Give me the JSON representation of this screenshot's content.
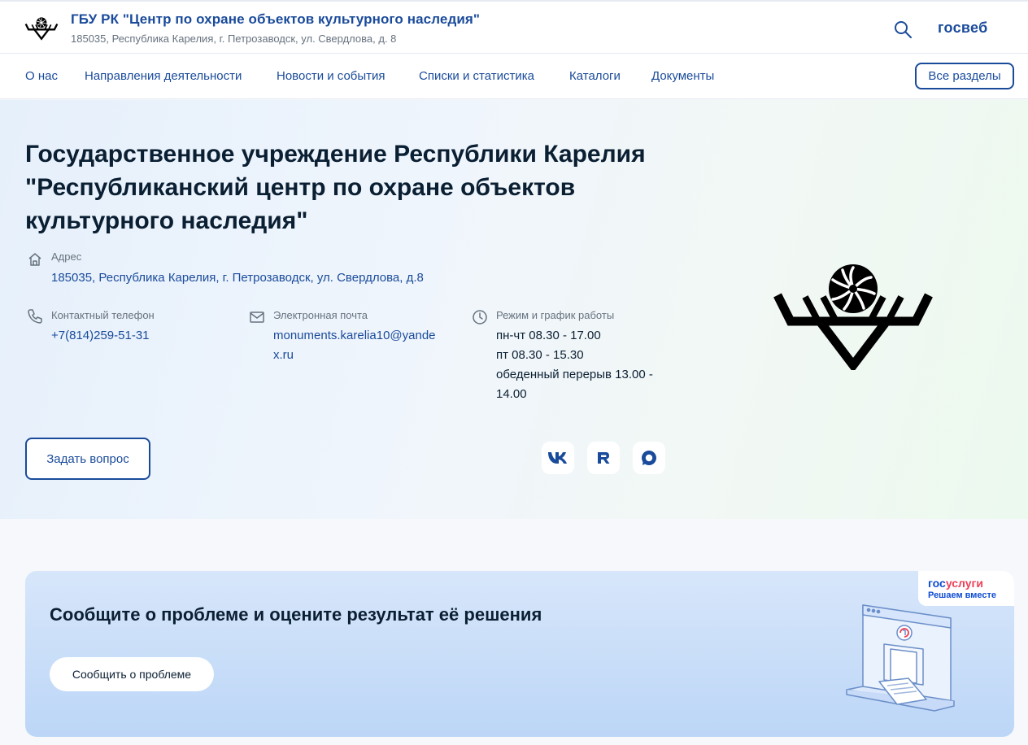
{
  "header": {
    "org_name": "ГБУ РК \"Центр по охране объектов культурного наследия\"",
    "org_address": "185035, Республика Карелия, г. Петрозаводск, ул. Свердлова, д. 8",
    "brand": "госвеб"
  },
  "nav": {
    "items": [
      "О нас",
      "Направления деятельности",
      "Новости и события",
      "Списки и статистика",
      "Каталоги",
      "Документы"
    ],
    "all_sections": "Все разделы"
  },
  "hero": {
    "title": "Государственное учреждение Республики Карелия \"Республиканский центр по охране объектов культурного наследия\"",
    "address_label": "Адрес",
    "address_value": "185035, Республика Карелия, г. Петрозаводск, ул. Свердлова, д.8",
    "phone_label": "Контактный телефон",
    "phone_value": "+7(814)259-51-31",
    "email_label": "Электронная почта",
    "email_line1": "monuments.karelia10@yande",
    "email_line2": "x.ru",
    "schedule_label": "Режим и график работы",
    "schedule_lines": [
      "пн-чт 08.30 - 17.00",
      "пт 08.30 - 15.30",
      "обеденный перерыв 13.00 -",
      "14.00"
    ],
    "ask_button": "Задать вопрос",
    "socials": [
      "vk-icon",
      "rutube-icon",
      "max-icon"
    ]
  },
  "banner": {
    "title": "Сообщите о проблеме и оцените результат её решения",
    "button": "Сообщить о проблеме",
    "gos_prefix": "гос",
    "gos_suffix": "услуги",
    "gos_sub": "Решаем вместе"
  },
  "colors": {
    "primary": "#1a4b9b",
    "text": "#0b1f33",
    "muted": "#66727f",
    "gosuslugi_blue": "#0d4cd3",
    "gosuslugi_red": "#ee3f58"
  }
}
